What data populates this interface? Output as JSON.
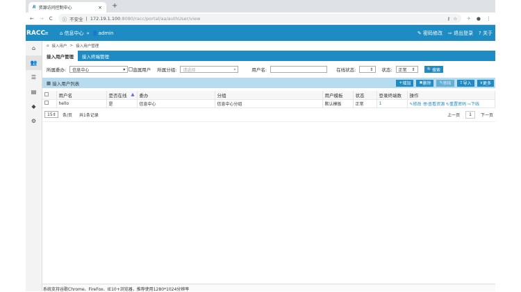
{
  "browser": {
    "tab_title": "资源访问控制中心",
    "insecure": "不安全",
    "url_host": "172.19.1.100",
    "url_rest": ":8080/racc/portal/aa/authUser/view"
  },
  "header": {
    "logo": "RACC",
    "crumb1": "信息中心",
    "crumb2": "admin",
    "pwd": "密码修改",
    "logout": "退出登录",
    "about": "关于"
  },
  "breadcrumb": {
    "a": "接入用户",
    "b": "接入用户管理"
  },
  "tabs": [
    "接入用户管理",
    "接入终端管理"
  ],
  "filter": {
    "org_label": "所属委办:",
    "org_value": "信息中心",
    "direct": "直属用户",
    "group_label": "所属分组:",
    "group_placeholder": "请选择",
    "user_label": "用户名:",
    "online_label": "在线状态:",
    "state_label": "状态:",
    "state_value": "正常",
    "search": "搜索"
  },
  "list": {
    "title": "接入用户列表",
    "add": "增加",
    "del": "删除",
    "audit": "审核",
    "import": "导入",
    "more": "更多"
  },
  "table": {
    "headers": [
      "用户名",
      "是否在线",
      "委办",
      "分组",
      "用户模板",
      "状态",
      "登录终端数",
      "操作"
    ],
    "rows": [
      {
        "name": "hello",
        "online": "是",
        "org": "信息中心",
        "group": "信息中心分组",
        "tpl": "默认模板",
        "state": "正常",
        "count": "1"
      }
    ],
    "ops": [
      "修改",
      "查看资源",
      "重置密码",
      "下线"
    ]
  },
  "footer": {
    "per_page": "15",
    "per_label": "条/页",
    "total": "共1条记录",
    "prev": "上一页",
    "page": "1",
    "next": "下一页"
  },
  "status": "系统支持谷歌Chrome、FireFox、IE10+浏览器，推荐使用1280*1024分辨率"
}
